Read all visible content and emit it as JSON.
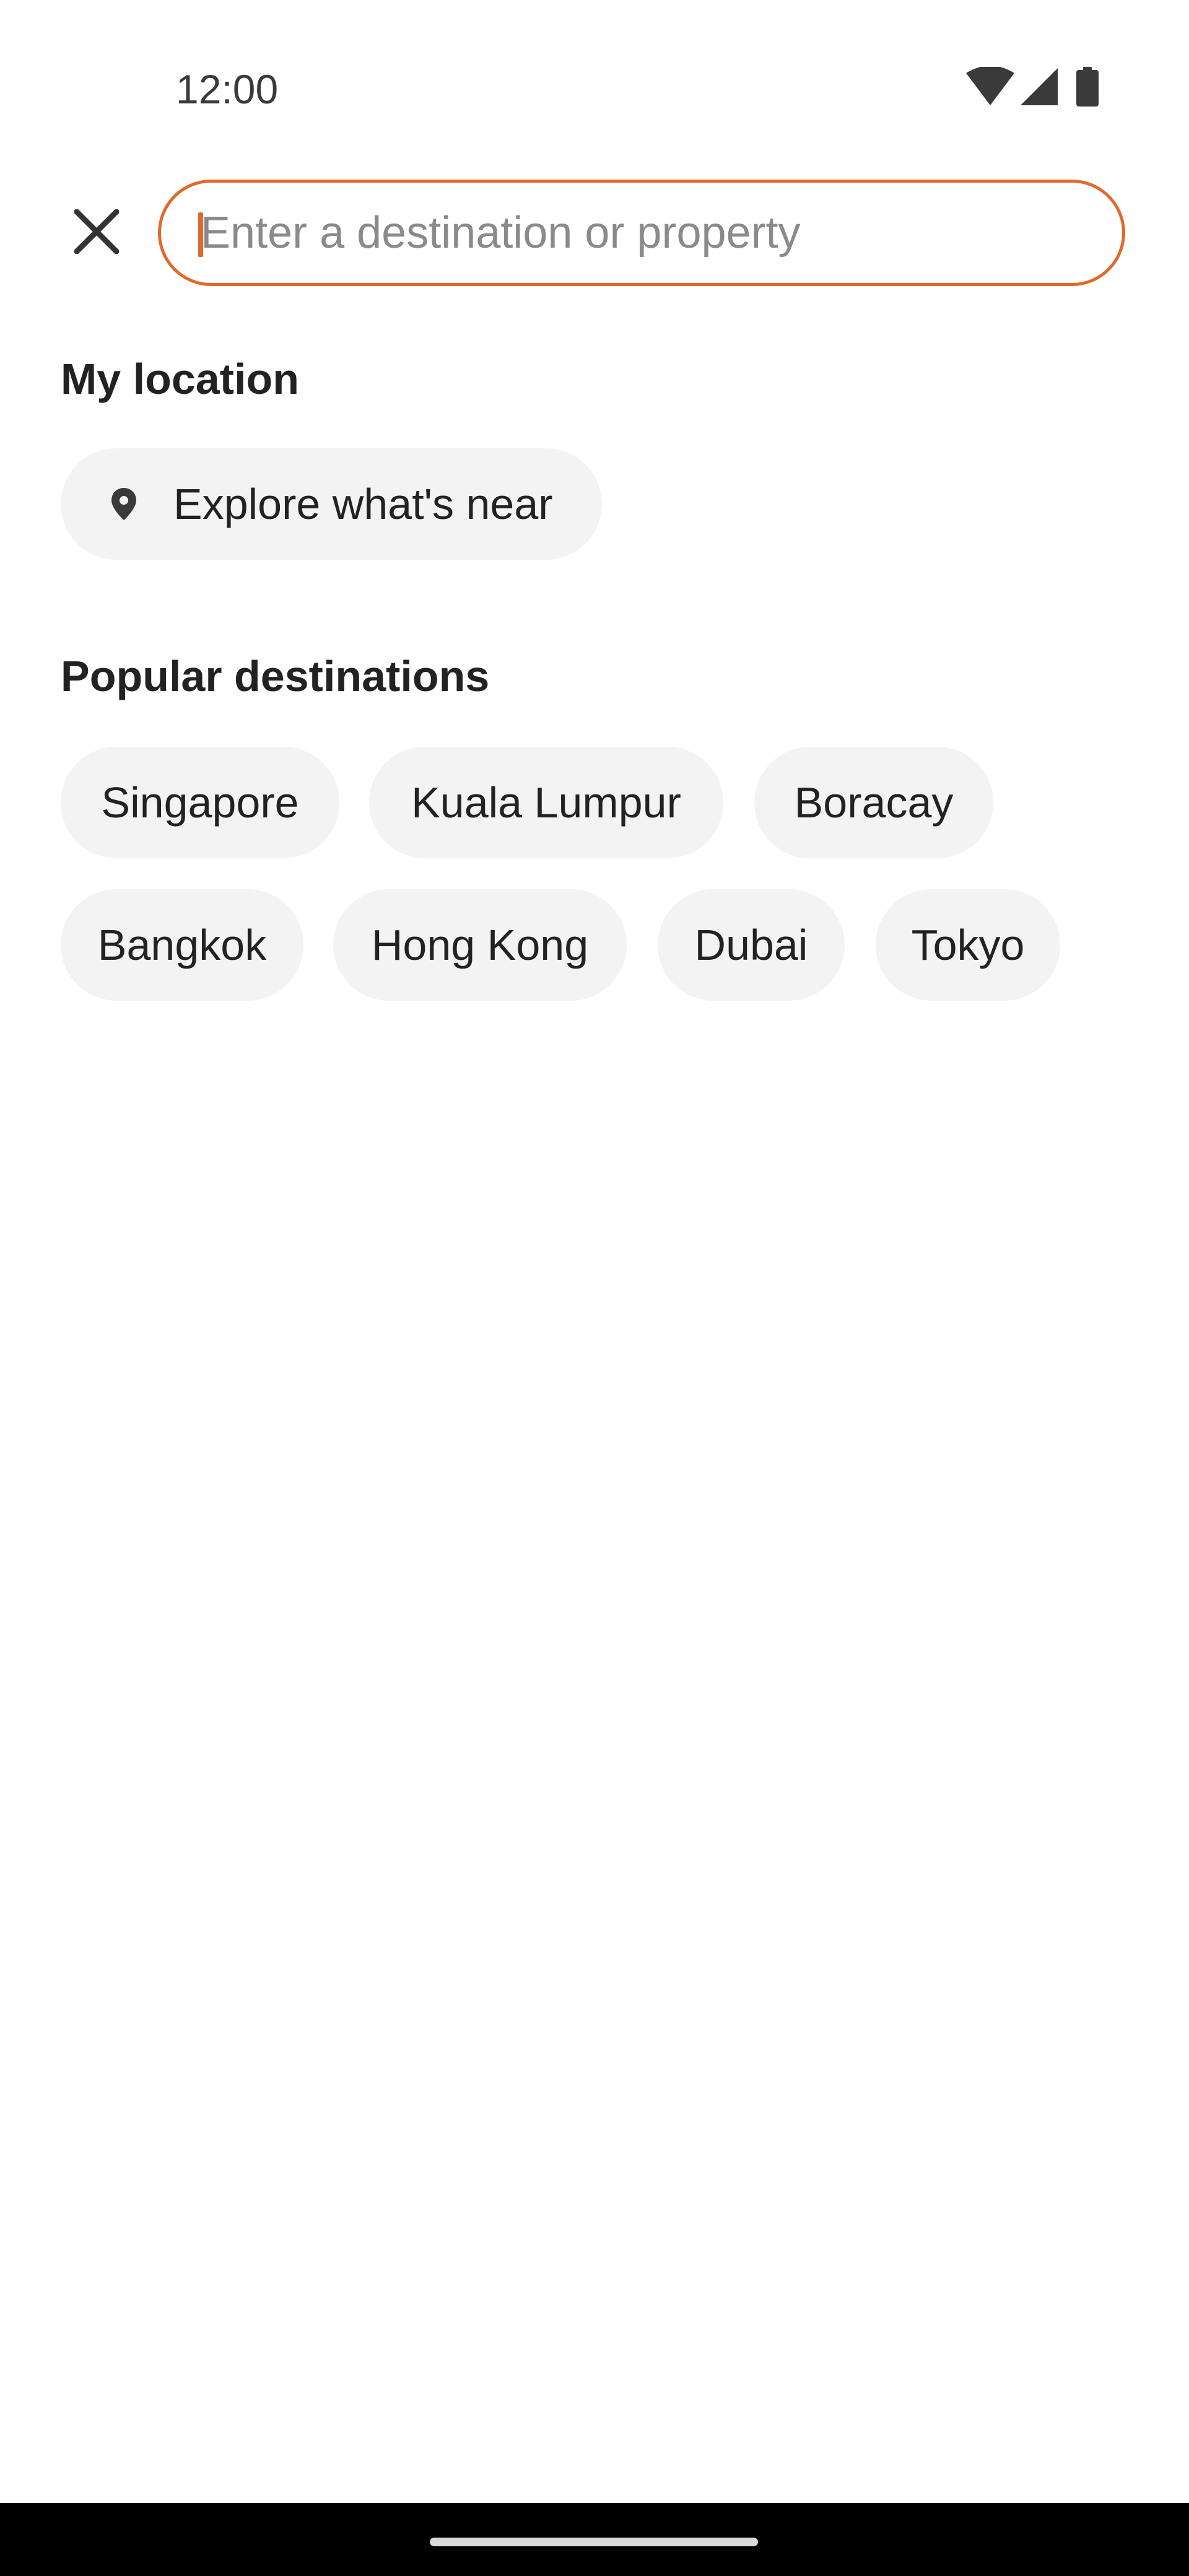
{
  "status_bar": {
    "time": "12:00",
    "icons": [
      "wifi-icon",
      "cellular-signal-icon",
      "battery-icon"
    ]
  },
  "search": {
    "value": "",
    "placeholder": "Enter a destination or property",
    "close_icon": "close-icon",
    "accent_color": "#e06a2c"
  },
  "my_location": {
    "title": "My location",
    "chip_label": "Explore what's near",
    "chip_icon": "location-pin-icon"
  },
  "popular": {
    "title": "Popular destinations",
    "destinations": [
      "Singapore",
      "Kuala Lumpur",
      "Boracay",
      "Bangkok",
      "Hong Kong",
      "Dubai",
      "Tokyo"
    ]
  }
}
